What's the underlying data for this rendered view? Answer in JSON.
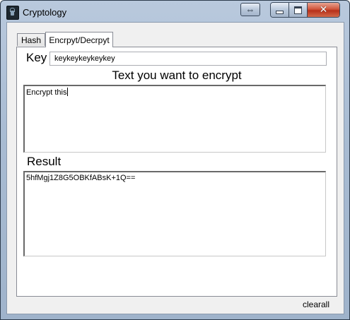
{
  "window": {
    "title": "Cryptology",
    "extra_button_glyph": "⇔",
    "close_glyph": "✕"
  },
  "tabs": [
    {
      "label": "Hash",
      "active": false
    },
    {
      "label": "Encrpyt/Decrpyt",
      "active": true
    }
  ],
  "encrypt_page": {
    "key_label": "Key",
    "key_value": "keykeykeykeykey",
    "prompt_label": "Text you want to encrypt",
    "plain_text": "Encrypt this",
    "result_label": "Result",
    "result_text": "5hfMgj1Z8G5OBKfABsK+1Q=="
  },
  "footer": {
    "clear_label": "clearall"
  },
  "colors": {
    "titlebar": "#a9bcd3",
    "client_bg": "#f0f0f0",
    "close_button": "#c9462c"
  }
}
